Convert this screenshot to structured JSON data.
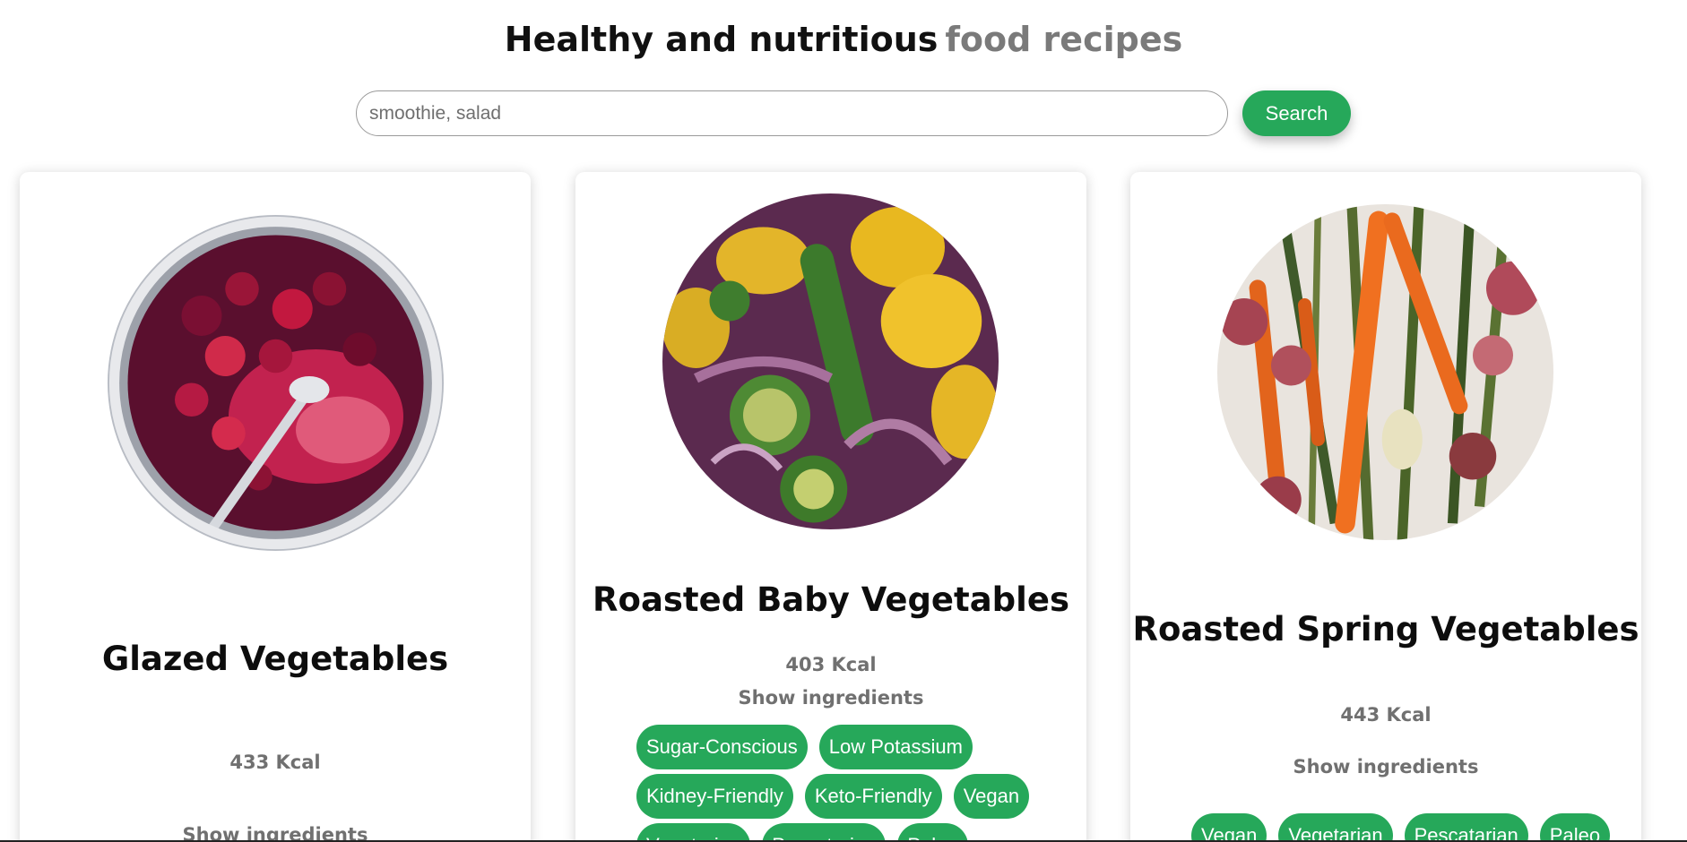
{
  "header": {
    "title_main": "Healthy and nutritious",
    "title_accent": "food recipes"
  },
  "search": {
    "placeholder": "smoothie, salad",
    "value": "",
    "button_label": "Search"
  },
  "cards": [
    {
      "title": "Glazed Vegetables",
      "kcal": "433 Kcal",
      "show_ingredients": "Show ingredients",
      "image": "beet-pot-photo",
      "tags": []
    },
    {
      "title": "Roasted Baby Vegetables",
      "kcal": "403 Kcal",
      "show_ingredients": "Show ingredients",
      "image": "roasted-squash-zucchini-photo",
      "tags": [
        "Sugar-Conscious",
        "Low Potassium",
        "Kidney-Friendly",
        "Keto-Friendly",
        "Vegan",
        "Vegetarian",
        "Pescatarian",
        "Paleo"
      ]
    },
    {
      "title": "Roasted Spring Vegetables",
      "kcal": "443 Kcal",
      "show_ingredients": "Show ingredients",
      "image": "roasted-carrots-asparagus-photo",
      "tags": [
        "Vegan",
        "Vegetarian",
        "Pescatarian",
        "Paleo"
      ]
    }
  ],
  "colors": {
    "accent": "#26a85a",
    "title_dark": "#111111",
    "title_muted": "#7a7a7a"
  }
}
